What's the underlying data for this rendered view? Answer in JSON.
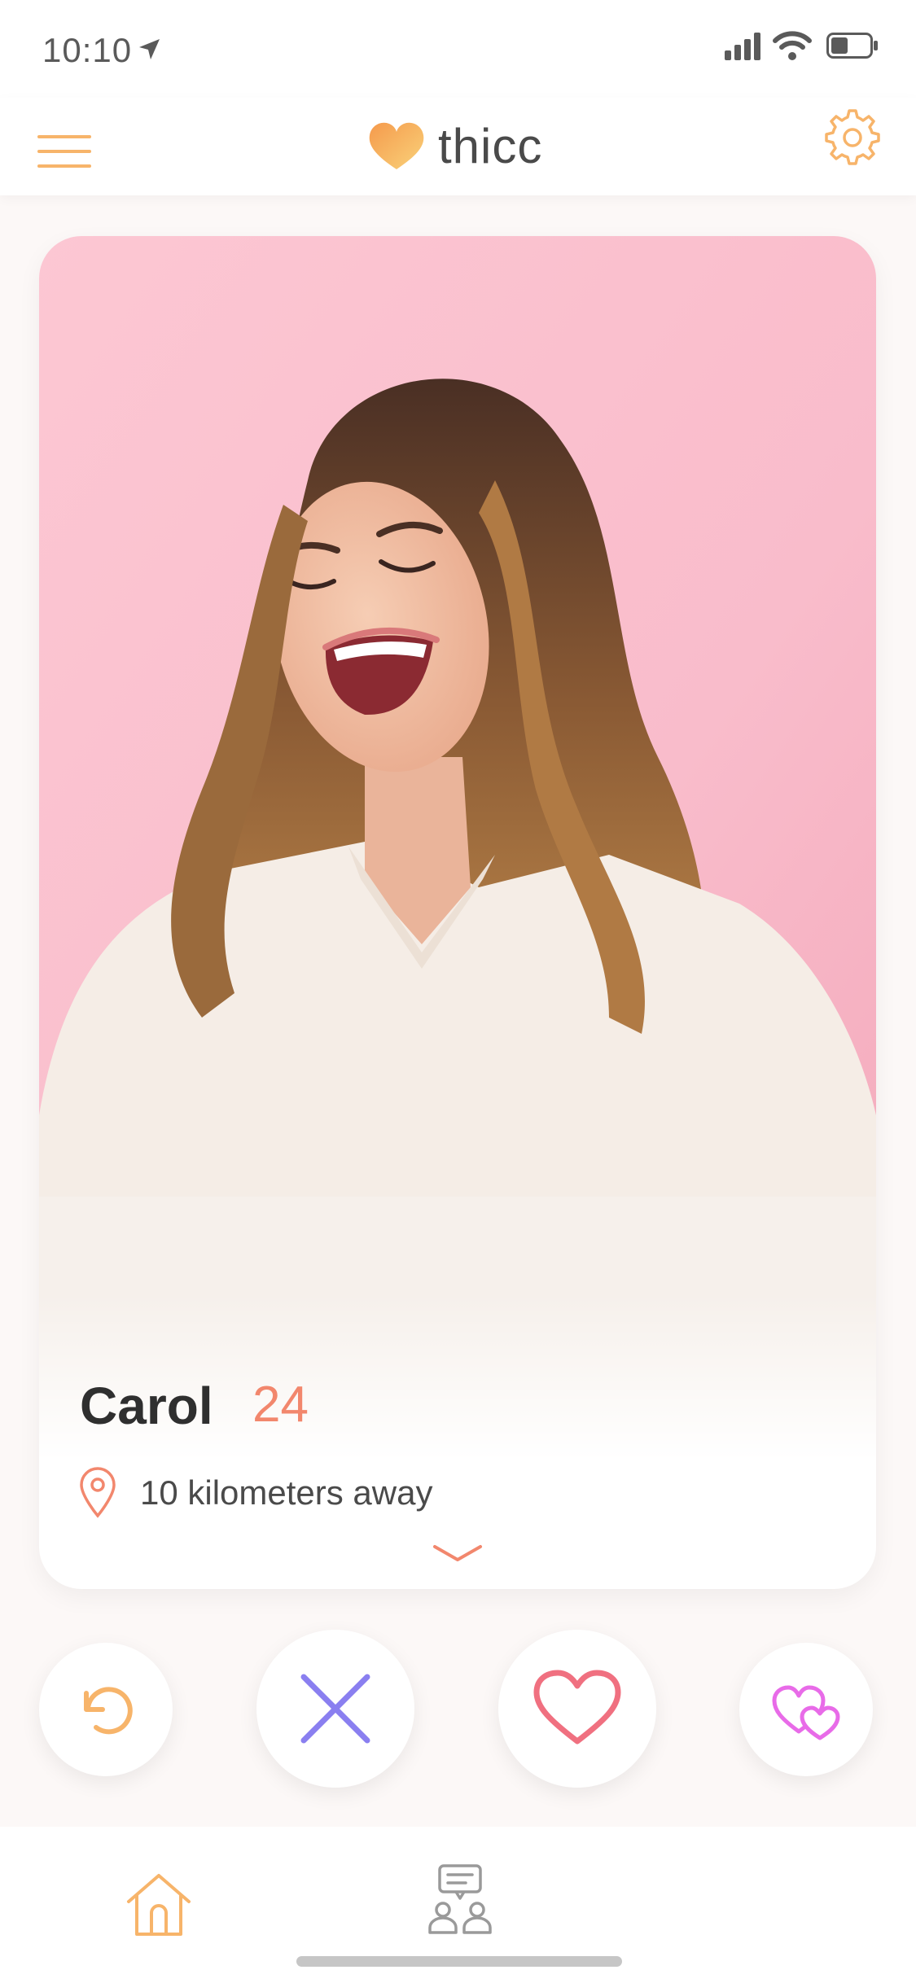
{
  "status_bar": {
    "time": "10:10",
    "icons": [
      "location-arrow-icon",
      "cellular-signal-icon",
      "wifi-icon",
      "battery-icon"
    ]
  },
  "header": {
    "brand_name": "thicc",
    "icons": [
      "hamburger-menu-icon",
      "heart-logo-icon",
      "gear-icon"
    ]
  },
  "profile": {
    "name": "Carol",
    "age": "24",
    "distance": "10 kilometers away",
    "icons": [
      "map-pin-icon",
      "chevron-down-icon"
    ]
  },
  "actions": [
    "undo-icon",
    "close-icon",
    "heart-icon",
    "double-heart-icon"
  ],
  "bottom_nav": {
    "items": [
      "home-icon",
      "matches-chat-icon"
    ],
    "active": "home"
  },
  "colors": {
    "accent_orange": "#f7b46a",
    "coral": "#f2876d",
    "nope_purple": "#8a7ff0",
    "like_red": "#f07080",
    "super_pink": "#e86be8",
    "photo_background": "#f7bcc9"
  }
}
